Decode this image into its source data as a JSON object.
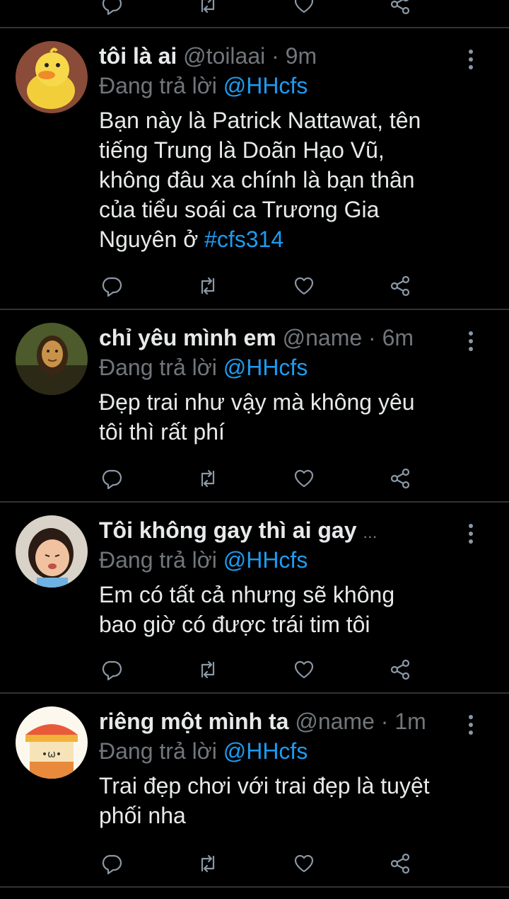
{
  "tweets": [
    {
      "display_name": "tôi là ai",
      "handle": "@toilaai",
      "time": "9m",
      "reply_prefix": "Đang trả lời",
      "reply_to": "@HHcfs",
      "text": "Bạn này là Patrick Nattawat, tên\ntiếng Trung là Doãn Hạo Vũ,\nkhông đâu xa chính là bạn thân\ncủa tiểu soái ca Trương Gia\nNguyên ở ",
      "hashtag": "#cfs314"
    },
    {
      "display_name": "chỉ yêu mình em",
      "handle": "@name",
      "time": "6m",
      "reply_prefix": "Đang trả lời",
      "reply_to": "@HHcfs",
      "text": "Đẹp trai như vậy mà không yêu\ntôi thì rất phí"
    },
    {
      "display_name": "Tôi không gay thì ai gay",
      "ellipsis": "...",
      "reply_prefix": "Đang trả lời",
      "reply_to": "@HHcfs",
      "text": "Em có tất cả nhưng sẽ không\nbao giờ có được trái tim tôi"
    },
    {
      "display_name": "riêng một mình ta",
      "handle": "@name",
      "time": "1m",
      "reply_prefix": "Đang trả lời",
      "reply_to": "@HHcfs",
      "text": "Trai đẹp chơi với trai đẹp là tuyệt\nphối nha",
      "avatar_text": "•ω•"
    }
  ],
  "icons": {
    "reply": "reply-icon",
    "retweet": "retweet-icon",
    "like": "heart-icon",
    "share": "share-icon",
    "more": "more-vertical-icon"
  },
  "colors": {
    "background": "#000000",
    "text": "#e7e9ea",
    "muted": "#71767b",
    "link": "#1d9bf0",
    "separator": "#2f3336"
  }
}
